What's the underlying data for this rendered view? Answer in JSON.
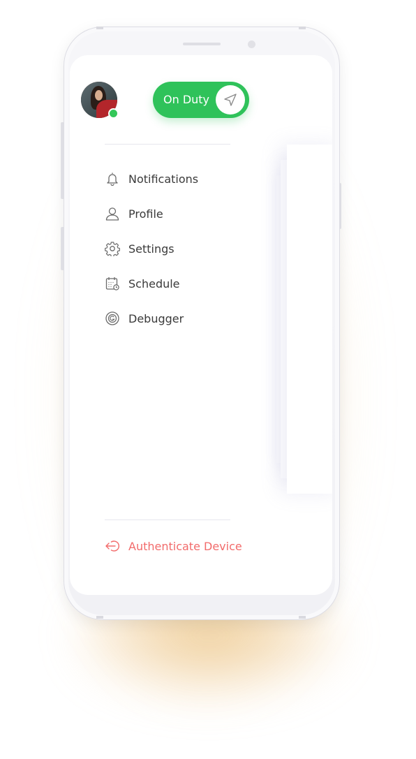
{
  "toggle": {
    "label": "On Duty",
    "state": "on",
    "color": "#2fc25a",
    "knob_icon": "send-icon"
  },
  "user": {
    "status": "online",
    "status_color": "#34c759"
  },
  "menu": {
    "items": [
      {
        "label": "Notifications",
        "icon": "bell-icon"
      },
      {
        "label": "Profile",
        "icon": "user-icon"
      },
      {
        "label": "Settings",
        "icon": "gear-icon"
      },
      {
        "label": "Schedule",
        "icon": "calendar-icon"
      },
      {
        "label": "Debugger",
        "icon": "debug-icon"
      }
    ]
  },
  "footer": {
    "auth_label": "Authenticate Device",
    "auth_icon": "logout-arrow-icon",
    "auth_color": "#f26b6b"
  }
}
